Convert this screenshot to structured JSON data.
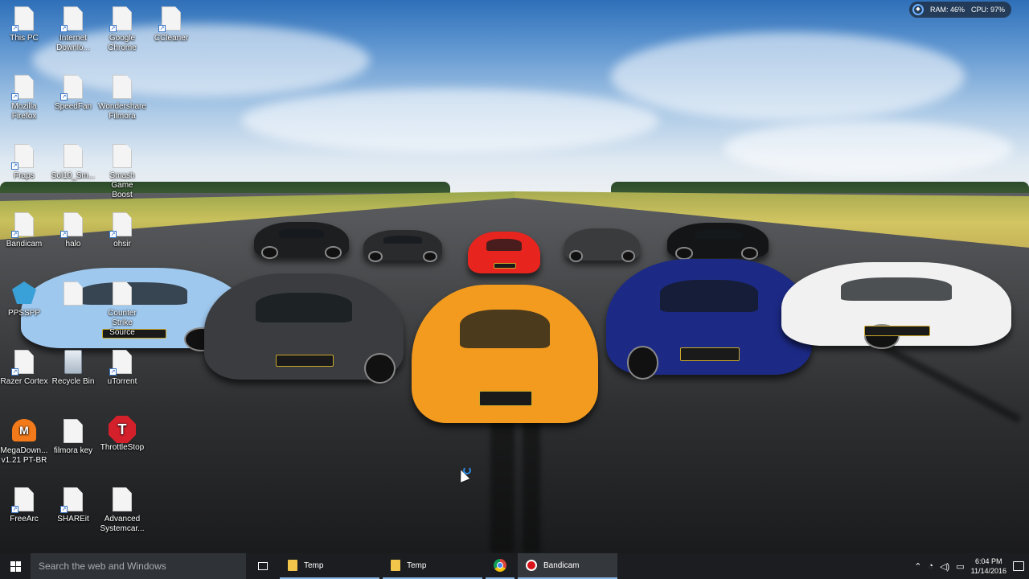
{
  "desktop": {
    "icons": [
      {
        "label": "This PC",
        "kind": "doc",
        "shortcut": true
      },
      {
        "label": "Internet\nDownlo...",
        "kind": "doc",
        "shortcut": true
      },
      {
        "label": "Google\nChrome",
        "kind": "doc",
        "shortcut": true
      },
      {
        "label": "CCleaner",
        "kind": "doc",
        "shortcut": true
      },
      {
        "label": "Mozilla\nFirefox",
        "kind": "doc",
        "shortcut": true
      },
      {
        "label": "SpeedFan",
        "kind": "doc",
        "shortcut": true
      },
      {
        "label": "Wondershare\nFilmora",
        "kind": "doc",
        "shortcut": false
      },
      {
        "label": "Fraps",
        "kind": "doc",
        "shortcut": true
      },
      {
        "label": "Sol10_Sm...",
        "kind": "doc",
        "shortcut": false
      },
      {
        "label": "Smash Game\nBoost",
        "kind": "doc",
        "shortcut": false
      },
      {
        "label": "Bandicam",
        "kind": "doc",
        "shortcut": true
      },
      {
        "label": "halo",
        "kind": "doc",
        "shortcut": true
      },
      {
        "label": "ohsir",
        "kind": "doc",
        "shortcut": true
      },
      {
        "label": "PPSSPP",
        "kind": "ppsspp",
        "shortcut": false
      },
      {
        "label": "",
        "kind": "doc",
        "shortcut": false
      },
      {
        "label": "Counter\nStrike Source",
        "kind": "doc",
        "shortcut": false
      },
      {
        "label": "Razer Cortex",
        "kind": "doc",
        "shortcut": true
      },
      {
        "label": "Recycle Bin",
        "kind": "recycle",
        "shortcut": false
      },
      {
        "label": "uTorrent",
        "kind": "doc",
        "shortcut": true
      },
      {
        "label": "MegaDown...\nv1.21 PT-BR",
        "kind": "mega",
        "shortcut": false
      },
      {
        "label": "filmora key",
        "kind": "doc",
        "shortcut": false
      },
      {
        "label": "ThrottleStop",
        "kind": "throttle",
        "shortcut": false
      },
      {
        "label": "FreeArc",
        "kind": "doc",
        "shortcut": true
      },
      {
        "label": "SHAREit",
        "kind": "doc",
        "shortcut": true
      },
      {
        "label": "Advanced\nSystemcar...",
        "kind": "doc",
        "shortcut": false
      }
    ]
  },
  "sysmon": {
    "ram": "RAM: 46%",
    "cpu": "CPU: 97%"
  },
  "taskbar": {
    "search_placeholder": "Search the web and Windows",
    "buttons": [
      {
        "label": "Temp",
        "icon": "folder-icon"
      },
      {
        "label": "Temp",
        "icon": "folder-icon"
      },
      {
        "label": "",
        "icon": "chrome-icon"
      },
      {
        "label": "Bandicam",
        "icon": "bandicam-icon"
      }
    ],
    "clock": {
      "time": "6:04 PM",
      "date": "11/14/2016"
    }
  },
  "colors": {
    "taskbar": "#1b1d20",
    "search_box": "#2f3236",
    "accent": "#8ab6e6"
  }
}
